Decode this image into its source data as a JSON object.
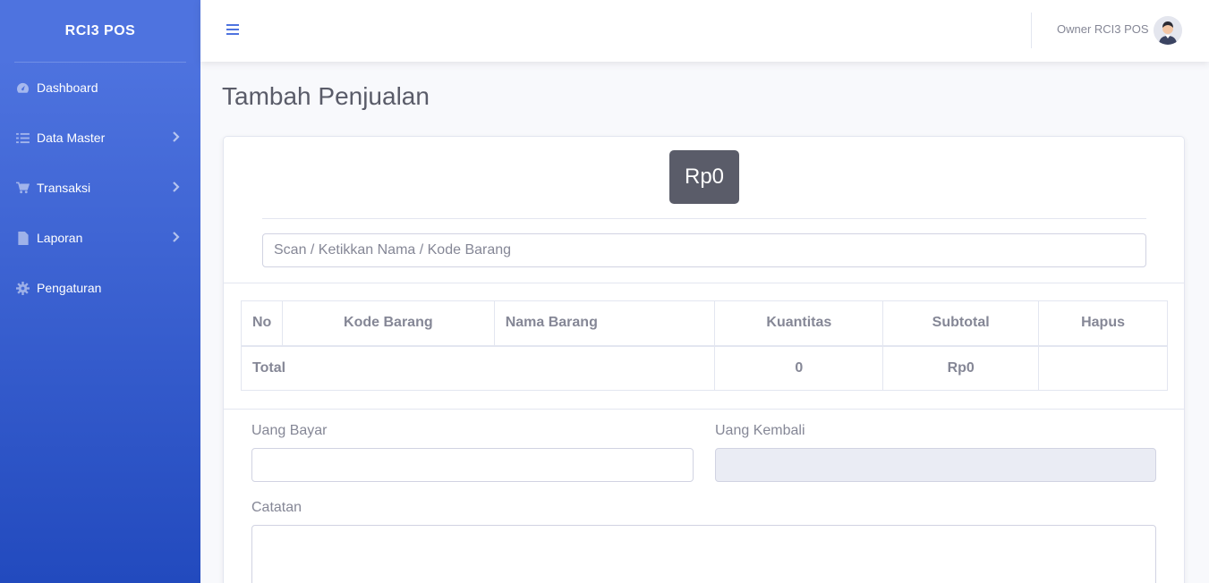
{
  "app": {
    "brand": "RCI3 POS"
  },
  "sidebar": {
    "items": [
      {
        "label": "Dashboard",
        "icon": "tachometer-icon",
        "has_submenu": false
      },
      {
        "label": "Data Master",
        "icon": "list-icon",
        "has_submenu": true
      },
      {
        "label": "Transaksi",
        "icon": "cart-icon",
        "has_submenu": true
      },
      {
        "label": "Laporan",
        "icon": "file-icon",
        "has_submenu": true
      },
      {
        "label": "Pengaturan",
        "icon": "gear-icon",
        "has_submenu": false
      }
    ]
  },
  "topbar": {
    "user_name": "Owner RCI3 POS",
    "menu_icon": "hamburger-icon"
  },
  "page": {
    "title": "Tambah Penjualan"
  },
  "sale": {
    "grand_total": "Rp0",
    "scan_placeholder": "Scan / Ketikkan Nama / Kode Barang",
    "table": {
      "headers": [
        "No",
        "Kode Barang",
        "Nama Barang",
        "Kuantitas",
        "Subtotal",
        "Hapus"
      ],
      "total_row": {
        "label": "Total",
        "quantity": "0",
        "subtotal": "Rp0"
      }
    },
    "payment": {
      "paid_label": "Uang Bayar",
      "paid_value": "",
      "change_label": "Uang Kembali",
      "change_value": "",
      "notes_label": "Catatan",
      "notes_value": ""
    }
  },
  "colors": {
    "sidebar_start": "#4e73df",
    "sidebar_end": "#224abe",
    "badge": "#5a5c69",
    "text_muted": "#858796"
  }
}
